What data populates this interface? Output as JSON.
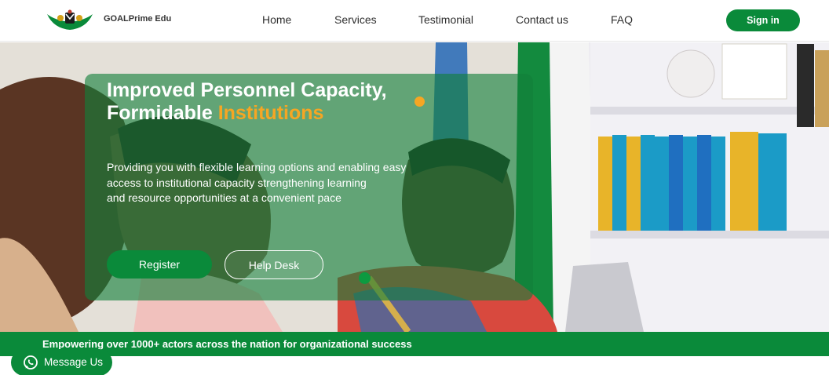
{
  "brand": {
    "name": "GOALPrime Edu",
    "logo_icon": "coat-of-arms-logo"
  },
  "nav": {
    "links": [
      "Home",
      "Services",
      "Testimonial",
      "Contact us",
      "FAQ"
    ],
    "signin_label": "Sign in"
  },
  "hero": {
    "headline_line1": "Improved Personnel Capacity,",
    "headline_line2_start": "Formidable",
    "headline_line2_accent": "Institutions",
    "subtext_line1": "Providing you with flexible learning options and enabling easy",
    "subtext_line2": "access to institutional capacity strengthening learning",
    "subtext_line3": "and resource opportunities at a convenient pace",
    "register_label": "Register",
    "helpdesk_label": "Help Desk"
  },
  "banner": {
    "text": "Empowering over 1000+ actors across the nation for organizational success"
  },
  "whatsapp": {
    "label": "Message Us",
    "icon": "whatsapp-icon"
  },
  "colors": {
    "primary_green": "#0a8a3a",
    "accent_orange": "#f6a623",
    "card_overlay": "rgba(18,128,58,0.62)"
  }
}
